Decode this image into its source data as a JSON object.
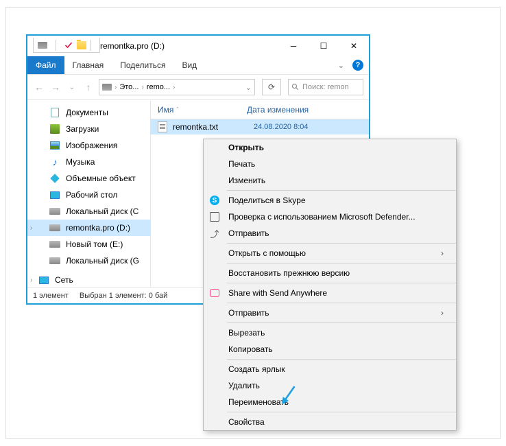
{
  "titlebar": {
    "title": "remontka.pro (D:)"
  },
  "ribbon": {
    "file": "Файл",
    "home": "Главная",
    "share": "Поделиться",
    "view": "Вид"
  },
  "breadcrumb": {
    "pc": "Это...",
    "drive": "remo...",
    "sep": "›"
  },
  "search": {
    "placeholder": "Поиск: remon"
  },
  "nav": {
    "documents": "Документы",
    "downloads": "Загрузки",
    "pictures": "Изображения",
    "music": "Музыка",
    "objects3d": "Объемные объект",
    "desktop": "Рабочий стол",
    "localC": "Локальный диск (C",
    "remontka": "remontka.pro (D:)",
    "newvol": "Новый том (E:)",
    "localG": "Локальный диск (G",
    "network": "Сеть"
  },
  "columns": {
    "name": "Имя",
    "date": "Дата изменения"
  },
  "file": {
    "name": "remontka.txt",
    "date": "24.08.2020 8:04"
  },
  "status": {
    "count": "1 элемент",
    "selected": "Выбран 1 элемент: 0 бай"
  },
  "menu": {
    "open": "Открыть",
    "print": "Печать",
    "edit": "Изменить",
    "skype": "Поделиться в Skype",
    "defender": "Проверка с использованием Microsoft Defender...",
    "send": "Отправить",
    "openWith": "Открыть с помощью",
    "restore": "Восстановить прежнюю версию",
    "sendAnywhere": "Share with Send Anywhere",
    "sendTo": "Отправить",
    "cut": "Вырезать",
    "copy": "Копировать",
    "shortcut": "Создать ярлык",
    "delete": "Удалить",
    "rename": "Переименовать",
    "properties": "Свойства"
  }
}
